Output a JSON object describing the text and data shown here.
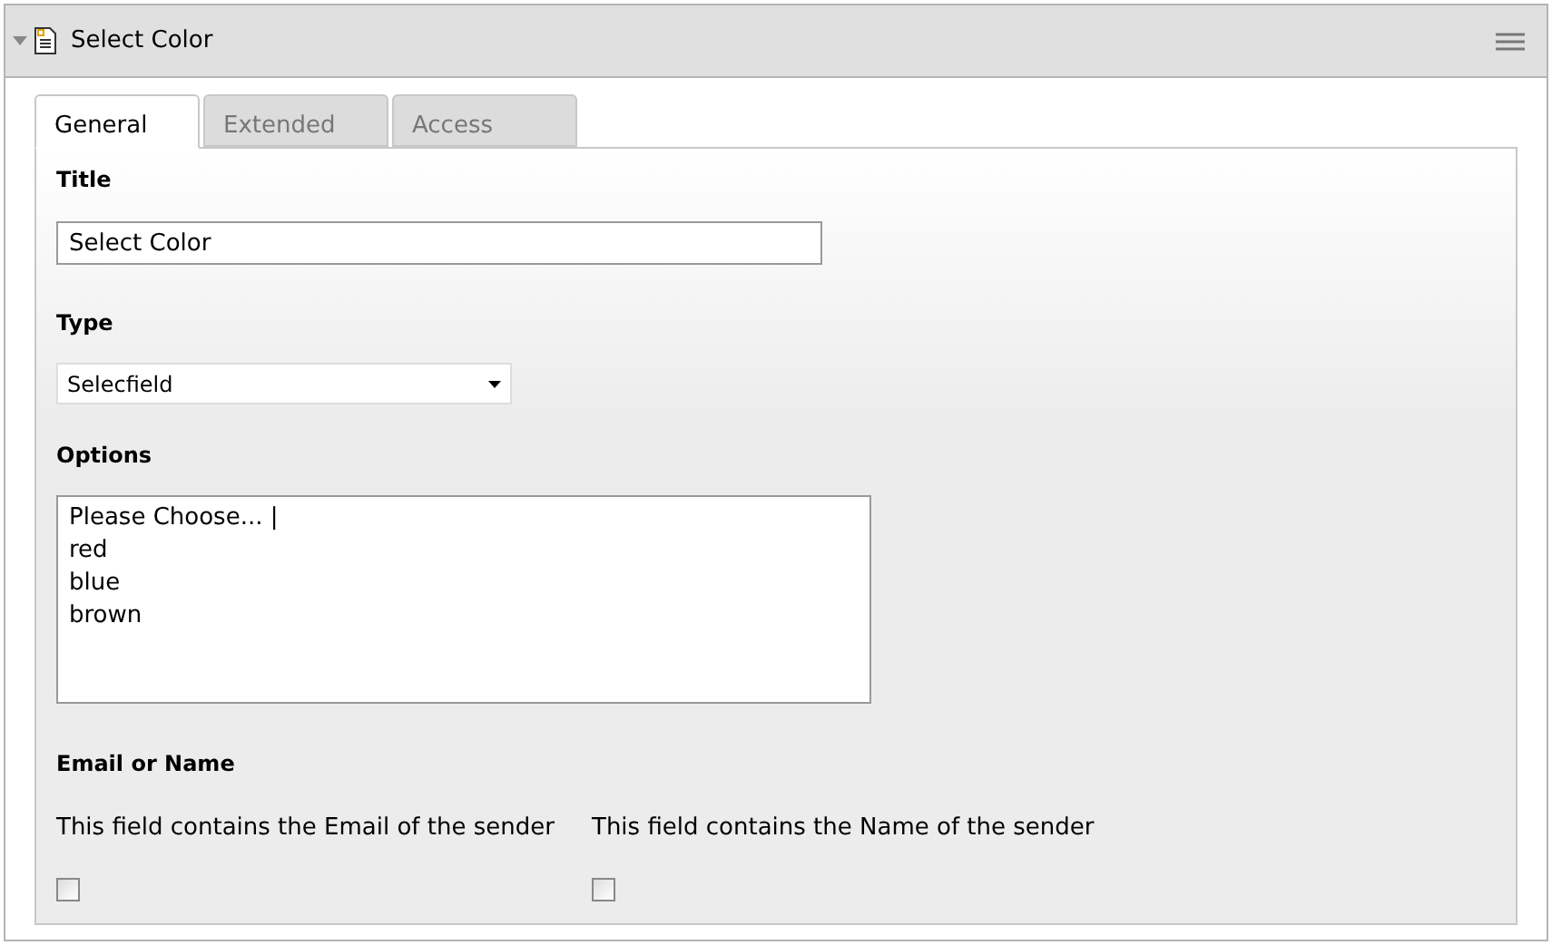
{
  "panel": {
    "title": "Select Color",
    "expanded": true
  },
  "tabs": [
    {
      "label": "General",
      "selected": true
    },
    {
      "label": "Extended",
      "selected": false
    },
    {
      "label": "Access",
      "selected": false
    }
  ],
  "title_field": {
    "label": "Title",
    "value": "Select Color"
  },
  "type_field": {
    "label": "Type",
    "value": "Selecfield"
  },
  "options_field": {
    "label": "Options",
    "lines": [
      "Please Choose... |",
      "red",
      "blue",
      "brown"
    ]
  },
  "email_or_name": {
    "label": "Email or Name",
    "options": [
      {
        "label": "This field contains the Email of the sender",
        "checked": false
      },
      {
        "label": "This field contains the Name of the sender",
        "checked": false
      }
    ]
  }
}
